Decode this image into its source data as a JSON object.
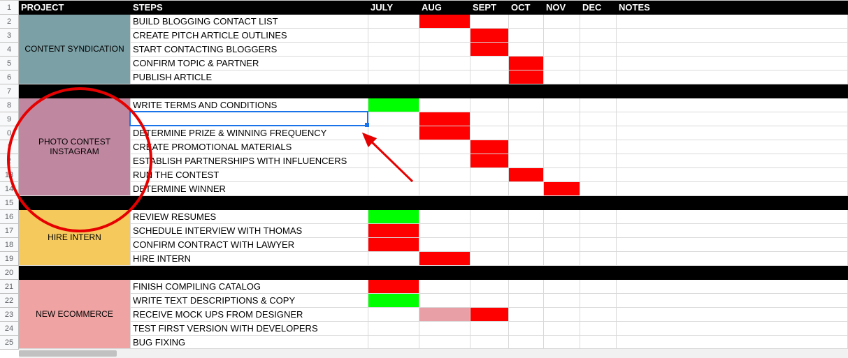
{
  "header": {
    "project": "PROJECT",
    "steps": "STEPS",
    "months": [
      "JULY",
      "AUG",
      "SEPT",
      "OCT",
      "NOV",
      "DEC"
    ],
    "notes": "NOTES"
  },
  "rowNumbers": [
    1,
    2,
    3,
    4,
    5,
    6,
    7,
    8,
    9,
    "0",
    "1",
    "2",
    13,
    14,
    15,
    16,
    17,
    18,
    19,
    "20",
    21,
    22,
    23,
    24,
    "25"
  ],
  "groups": [
    {
      "name": "CONTENT SYNDICATION",
      "color": "steel",
      "steps": [
        {
          "label": "BUILD BLOGGING CONTACT LIST",
          "status": {
            "AUG": "red"
          }
        },
        {
          "label": "CREATE PITCH ARTICLE OUTLINES",
          "status": {
            "SEPT": "red"
          }
        },
        {
          "label": "START CONTACTING BLOGGERS",
          "status": {
            "SEPT": "red"
          }
        },
        {
          "label": "CONFIRM TOPIC & PARTNER",
          "status": {
            "OCT": "red"
          }
        },
        {
          "label": "PUBLISH ARTICLE",
          "status": {
            "OCT": "red"
          }
        }
      ]
    },
    {
      "name": "PHOTO CONTEST INSTAGRAM",
      "color": "mauve",
      "steps": [
        {
          "label": "WRITE TERMS AND CONDITIONS",
          "status": {
            "JULY": "green"
          }
        },
        {
          "label": "",
          "status": {
            "AUG": "red"
          }
        },
        {
          "label": "DETERMINE PRIZE & WINNING FREQUENCY",
          "status": {
            "AUG": "red"
          }
        },
        {
          "label": "CREATE PROMOTIONAL MATERIALS",
          "status": {
            "SEPT": "red"
          }
        },
        {
          "label": "ESTABLISH PARTNERSHIPS WITH INFLUENCERS",
          "status": {
            "SEPT": "red"
          }
        },
        {
          "label": "RUN THE CONTEST",
          "status": {
            "OCT": "red"
          }
        },
        {
          "label": "DETERMINE WINNER",
          "status": {
            "NOV": "red"
          }
        }
      ]
    },
    {
      "name": "HIRE INTERN",
      "color": "gold",
      "steps": [
        {
          "label": "REVIEW RESUMES",
          "status": {
            "JULY": "green"
          }
        },
        {
          "label": "SCHEDULE INTERVIEW WITH THOMAS",
          "status": {
            "JULY": "red"
          }
        },
        {
          "label": "CONFIRM CONTRACT WITH LAWYER",
          "status": {
            "JULY": "red"
          }
        },
        {
          "label": "HIRE INTERN",
          "status": {
            "AUG": "red"
          }
        }
      ]
    },
    {
      "name": "NEW ECOMMERCE",
      "color": "salmon",
      "steps": [
        {
          "label": "FINISH COMPILING CATALOG",
          "status": {
            "JULY": "red"
          }
        },
        {
          "label": "WRITE TEXT DESCRIPTIONS & COPY",
          "status": {
            "JULY": "green"
          }
        },
        {
          "label": "RECEIVE MOCK UPS FROM DESIGNER",
          "status": {
            "AUG": "pink",
            "SEPT": "red"
          }
        },
        {
          "label": "TEST FIRST VERSION WITH DEVELOPERS",
          "status": {}
        },
        {
          "label": "BUG FIXING",
          "status": {}
        }
      ]
    }
  ],
  "annotation": {
    "targetGroup": "PHOTO CONTEST INSTAGRAM",
    "arrowTargetCell": "steps-row-9"
  }
}
